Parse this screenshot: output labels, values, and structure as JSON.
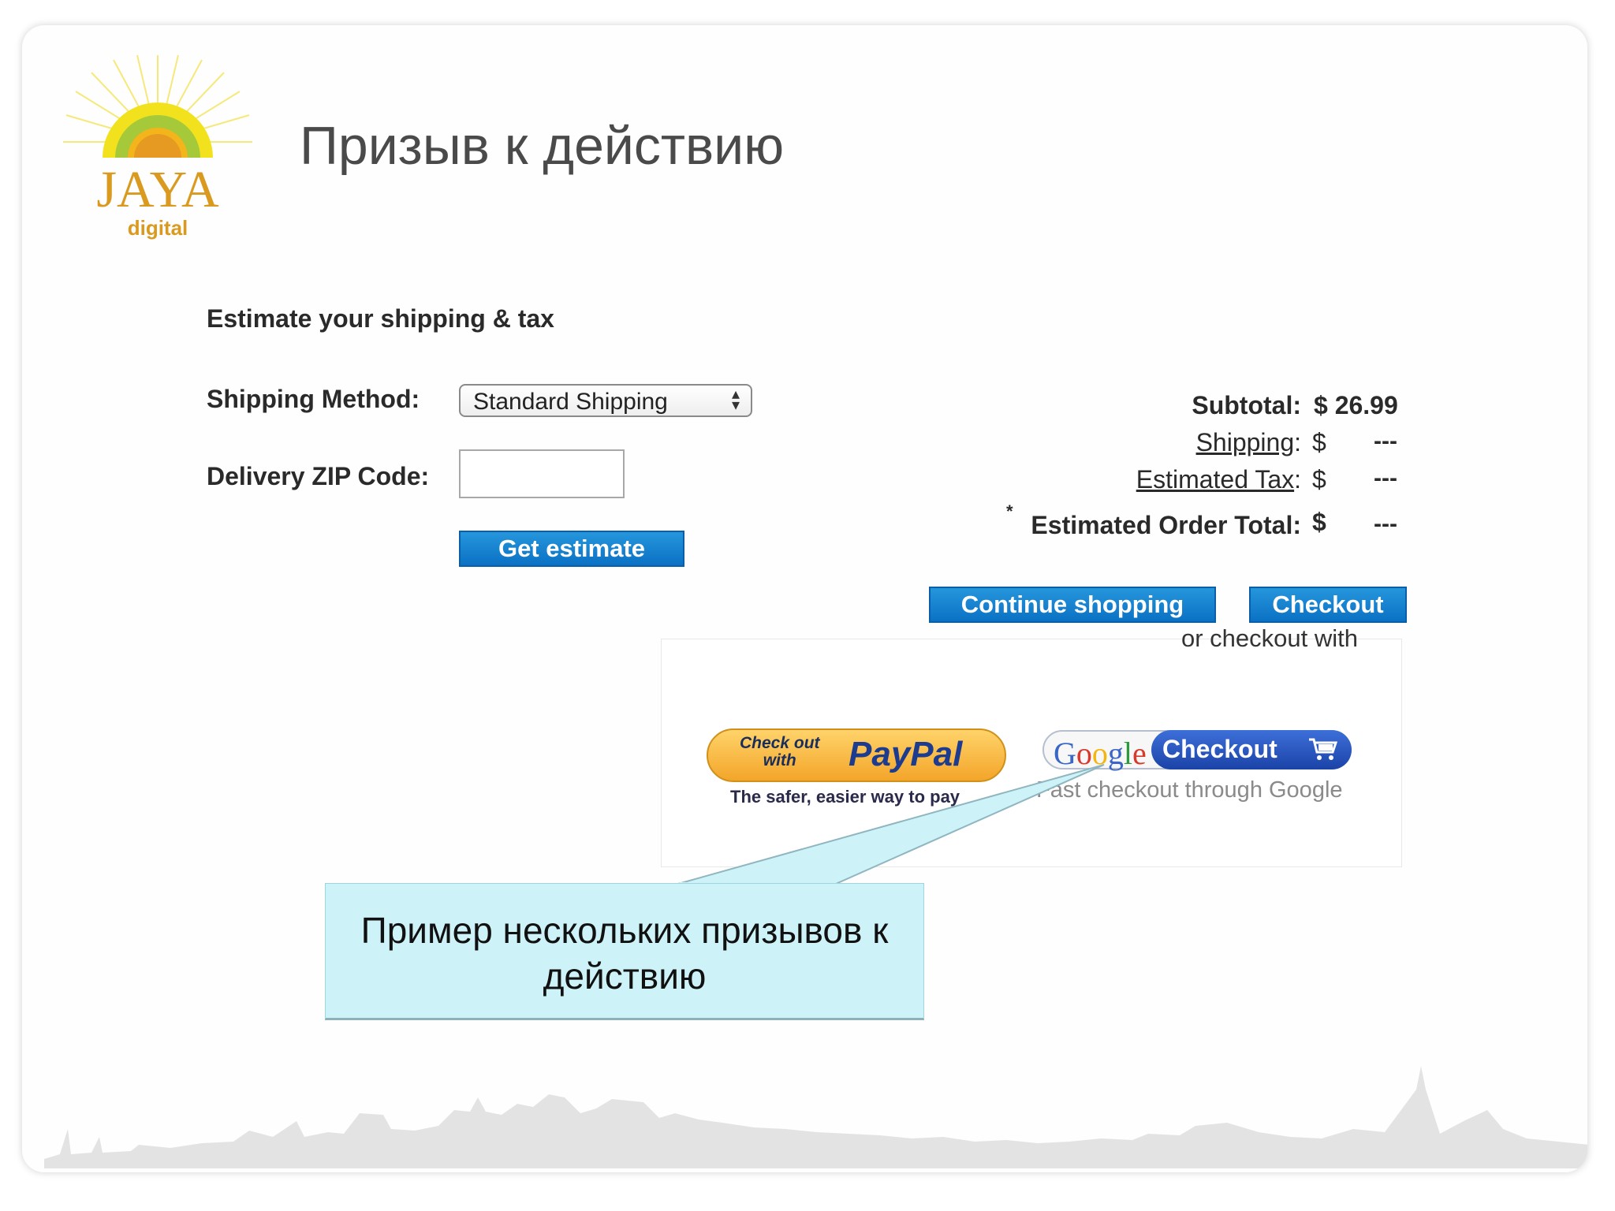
{
  "slide": {
    "title": "Призыв к действию",
    "logo": {
      "brand": "JAYA",
      "sub": "digital"
    }
  },
  "cart": {
    "section_title": "Estimate your shipping & tax",
    "shipping_method_label": "Shipping Method:",
    "shipping_method_value": "Standard Shipping",
    "zip_label": "Delivery ZIP Code:",
    "zip_value": "",
    "get_estimate_label": "Get estimate",
    "totals": {
      "subtotal_label": "Subtotal:",
      "subtotal_value": "$ 26.99",
      "shipping_label": "Shipping",
      "tax_label": "Estimated Tax",
      "total_label": "Estimated Order Total:",
      "colon": ":",
      "currency": "$",
      "placeholder_value": "---",
      "asterisk": "*"
    },
    "continue_shopping_label": "Continue shopping",
    "checkout_label": "Checkout",
    "or_checkout_with": "or checkout with",
    "paypal": {
      "small_text_1": "Check out",
      "small_text_2": "with",
      "brand": "PayPal",
      "caption": "The safer, easier way to pay"
    },
    "google": {
      "brand_letters": [
        "G",
        "o",
        "o",
        "g",
        "l",
        "e"
      ],
      "button_label": "Checkout",
      "caption": "Fast checkout through Google"
    }
  },
  "callout": {
    "text_line1": "Пример нескольких призывов к",
    "text_line2": "действию"
  },
  "colors": {
    "accent_blue": "#0b71c4",
    "callout_bg": "#cdf3f8",
    "logo_orange": "#e8a020",
    "paypal_yellow": "#f3a52a",
    "google_blue": "#1b43a8"
  }
}
